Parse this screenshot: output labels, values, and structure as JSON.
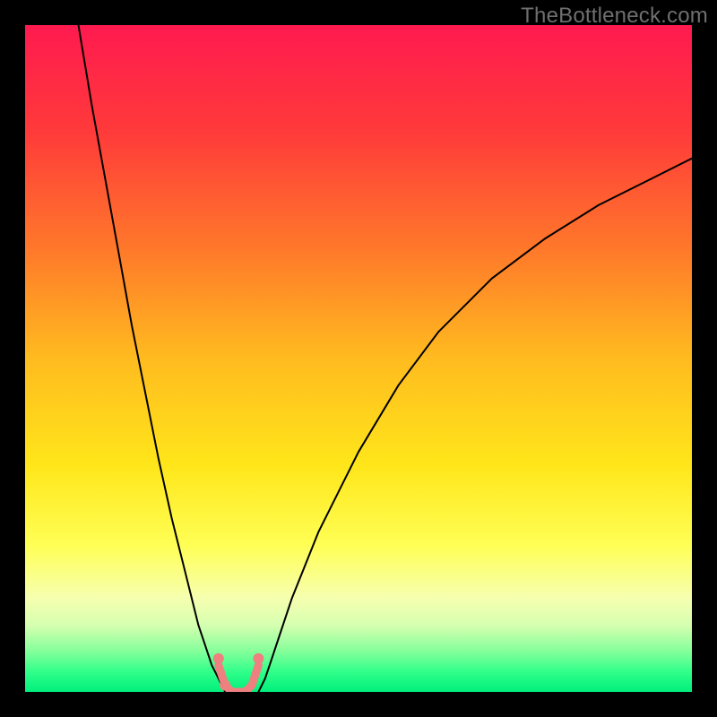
{
  "watermark": "TheBottleneck.com",
  "chart_data": {
    "type": "line",
    "title": "",
    "xlabel": "",
    "ylabel": "",
    "xlim": [
      0,
      100
    ],
    "ylim": [
      0,
      100
    ],
    "legend": false,
    "grid": false,
    "background_gradient": {
      "stops": [
        {
          "offset": 0.0,
          "color": "#ff1a4f"
        },
        {
          "offset": 0.16,
          "color": "#ff3a3a"
        },
        {
          "offset": 0.34,
          "color": "#ff7a2a"
        },
        {
          "offset": 0.5,
          "color": "#ffbb1f"
        },
        {
          "offset": 0.66,
          "color": "#ffe61a"
        },
        {
          "offset": 0.78,
          "color": "#ffff55"
        },
        {
          "offset": 0.86,
          "color": "#f6ffb0"
        },
        {
          "offset": 0.9,
          "color": "#d6ffb0"
        },
        {
          "offset": 0.94,
          "color": "#82ff9a"
        },
        {
          "offset": 0.97,
          "color": "#30ff8a"
        },
        {
          "offset": 1.0,
          "color": "#00ef7c"
        }
      ]
    },
    "series": [
      {
        "name": "curve-left",
        "stroke": "#000000",
        "stroke_width": 2,
        "x": [
          8,
          10,
          12,
          14,
          16,
          18,
          20,
          22,
          24,
          26,
          27,
          28,
          29,
          30
        ],
        "y": [
          100,
          88,
          77,
          66,
          55,
          45,
          35,
          26,
          18,
          10,
          7,
          4,
          2,
          0
        ]
      },
      {
        "name": "curve-right",
        "stroke": "#000000",
        "stroke_width": 2,
        "x": [
          35,
          36,
          37,
          38,
          40,
          44,
          50,
          56,
          62,
          70,
          78,
          86,
          94,
          100
        ],
        "y": [
          0,
          2,
          5,
          8,
          14,
          24,
          36,
          46,
          54,
          62,
          68,
          73,
          77,
          80
        ]
      },
      {
        "name": "valley-floor",
        "stroke": "#ee8080",
        "stroke_width": 9,
        "x": [
          29,
          30,
          31,
          32,
          33,
          34,
          35
        ],
        "y": [
          4,
          1,
          0,
          0,
          0,
          1,
          4
        ]
      }
    ],
    "markers": [
      {
        "name": "dot-left-upper",
        "x": 29,
        "y": 5,
        "r": 6,
        "fill": "#ee8080"
      },
      {
        "name": "dot-left-lower",
        "x": 30,
        "y": 1,
        "r": 6,
        "fill": "#ee8080"
      },
      {
        "name": "dot-right",
        "x": 35,
        "y": 5,
        "r": 6,
        "fill": "#ee8080"
      }
    ]
  }
}
